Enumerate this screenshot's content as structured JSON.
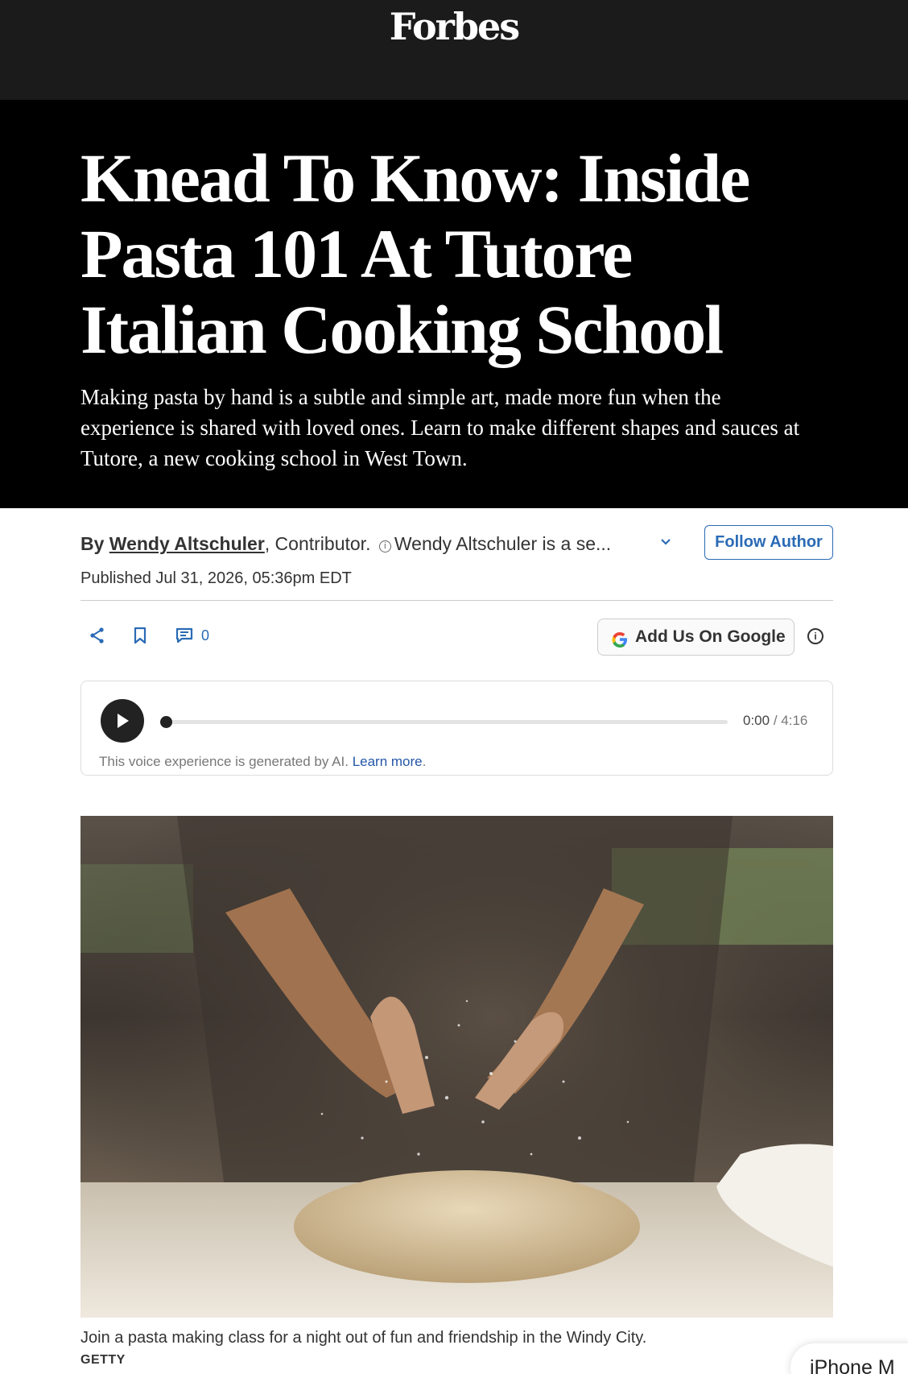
{
  "header": {
    "logo": "Forbes"
  },
  "article": {
    "headline": "Knead To Know: Inside Pasta 101 At Tutore Italian Cooking School",
    "dek": "Making pasta by hand is a subtle and simple art, made more fun when the experience is shared with loved ones. Learn to make different shapes and sauces at Tutore, a new cooking school in West Town."
  },
  "byline": {
    "by": "By",
    "author": "Wendy Altschuler",
    "role": ", Contributor.",
    "bio_teaser": "Wendy Altschuler is a se...",
    "follow_label": "Follow Author",
    "published": "Published Jul 31, 2026, 05:36pm EDT"
  },
  "actions": {
    "share_icon": "share-icon",
    "bookmark_icon": "bookmark-icon",
    "comment_icon": "comment-icon",
    "comment_count": "0",
    "add_google_label": "Add Us On Google"
  },
  "audio": {
    "current": "0:00",
    "separator": " / ",
    "duration": "4:16",
    "progress": 0,
    "note": "This voice experience is generated by AI.",
    "learn_more": "Learn more",
    "note_end": "."
  },
  "photo": {
    "caption": "Join a pasta making class for a night out of fun and friendship in the Windy City.",
    "credit": "GETTY"
  },
  "promo": {
    "label": "iPhone M"
  },
  "colors": {
    "accent": "#2a6bb5",
    "hero_bg": "#000000",
    "topbar_bg": "#1b1b1b"
  }
}
